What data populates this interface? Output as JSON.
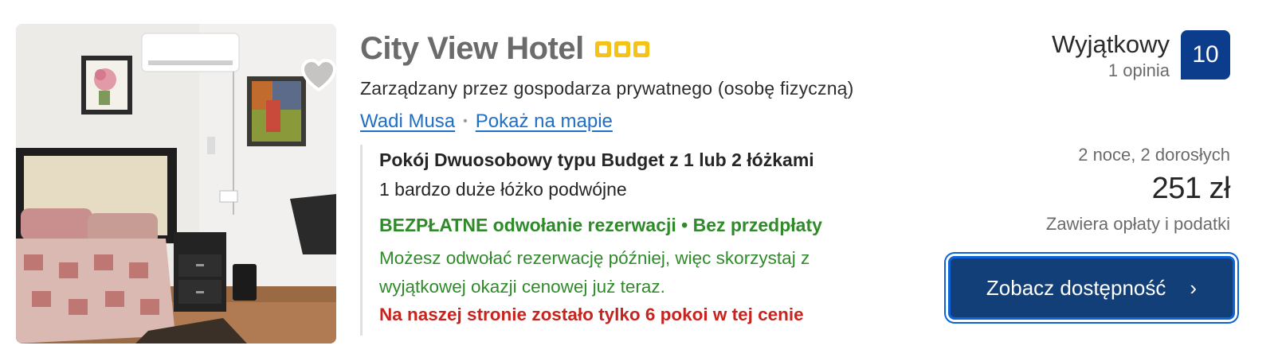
{
  "hotel": {
    "name": "City View Hotel",
    "stars": 3,
    "managed_by": "Zarządzany przez gospodarza prywatnego (osobę fizyczną)",
    "location_link": "Wadi Musa",
    "map_link": "Pokaż na mapie",
    "separator": "•"
  },
  "room": {
    "name": "Pokój Dwuosobowy typu Budget z 1 lub 2 łóżkami",
    "bed": "1 bardzo duże łóżko podwójne",
    "cancellation": "BEZPŁATNE odwołanie rezerwacji • Bez przedpłaty",
    "cancellation_note": "Możesz odwołać rezerwację później, więc skorzystaj z wyjątkowej okazji cenowej już teraz.",
    "scarcity": "Na naszej stronie zostało tylko 6 pokoi w tej cenie"
  },
  "review": {
    "word": "Wyjątkowy",
    "count": "1 opinia",
    "score": "10"
  },
  "pricing": {
    "stay": "2 noce, 2 dorosłych",
    "price": "251 zł",
    "taxes": "Zawiera opłaty i podatki"
  },
  "cta": {
    "label": "Zobacz dostępność",
    "chevron": "›"
  },
  "icons": {
    "favorite": "heart-icon",
    "star": "star-icon",
    "chevron": "chevron-right-icon"
  },
  "colors": {
    "title": "#6b6b6b",
    "link": "#1f6fc5",
    "green": "#2f8a2a",
    "red": "#c8241f",
    "badge": "#0c3d8c",
    "button": "#123f77",
    "star": "#f5c219"
  }
}
